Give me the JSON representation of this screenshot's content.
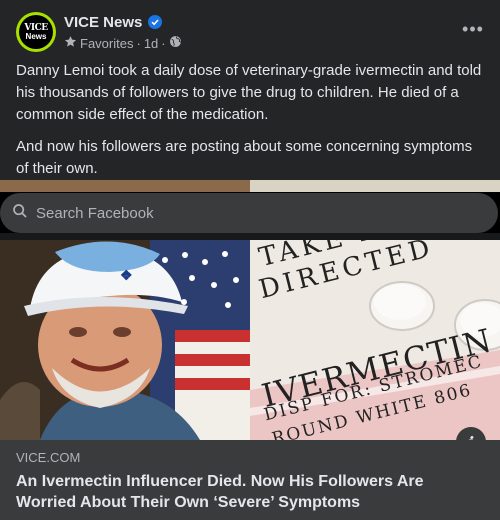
{
  "post": {
    "page_name": "VICE News",
    "avatar_text_line1": "VICE",
    "avatar_text_line2": "News",
    "audience": "Favorites",
    "separator": "·",
    "time": "1d",
    "more_icon": "ellipsis-icon",
    "paragraphs": [
      "Danny Lemoi took a daily dose of veterinary-grade ivermectin and told his thousands of followers to give the drug to children. He died of a common side effect of the medication.",
      "And now his followers are posting about some concerning symptoms of their own."
    ]
  },
  "search": {
    "placeholder": "Search Facebook"
  },
  "preview": {
    "image_label_lines": [
      "TAKE I",
      "DIRECTED",
      "IVERMECTIN",
      "DISP FOR: STROMEC",
      "ROUND WHITE 806"
    ],
    "domain": "VICE.COM",
    "title": "An Ivermectin Influencer Died. Now His Followers Are Worried About Their Own ‘Severe’ Symptoms",
    "info_label": "i"
  },
  "colors": {
    "background": "#242526",
    "footer": "#3a3b3c",
    "verified": "#1b74e4",
    "avatar_ring": "#a8e000"
  }
}
